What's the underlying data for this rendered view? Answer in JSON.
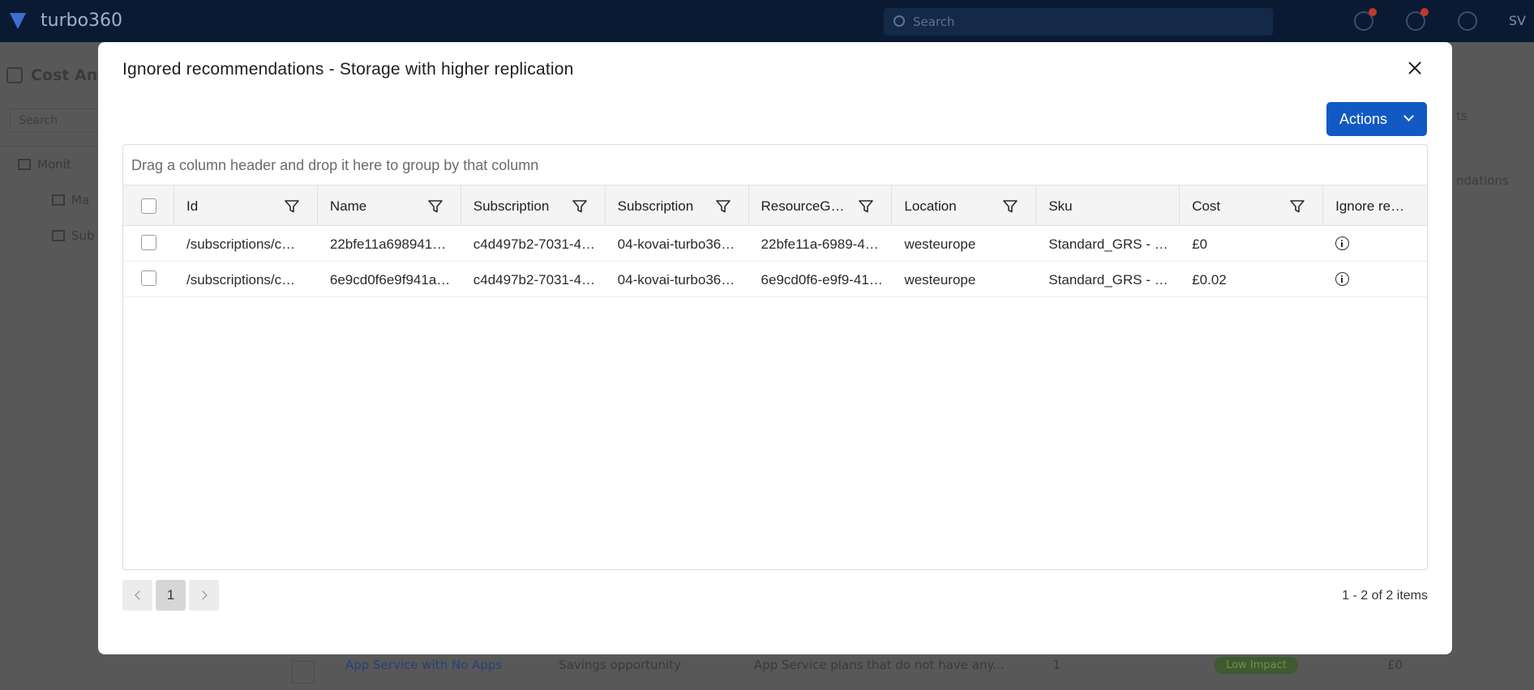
{
  "app": {
    "brand": "turbo360",
    "search_placeholder": "Search",
    "user_initials": "SV",
    "page_title": "Cost An",
    "sidebar_search": "Search",
    "sidebar_items": [
      "Monit",
      "Ma",
      "Sub"
    ],
    "bg_right_labels": [
      "ts",
      "ndations"
    ],
    "bg_row": {
      "name": "App Service with No Apps",
      "category": "Savings opportunity",
      "description": "App Service plans that do not have any...",
      "count": "1",
      "status": "Low Impact",
      "extra": "£0"
    }
  },
  "modal": {
    "title": "Ignored recommendations - Storage with higher replication",
    "actions_label": "Actions",
    "group_panel_hint": "Drag a column header and drop it here to group by that column",
    "columns": [
      {
        "label": "Id",
        "filter": true
      },
      {
        "label": "Name",
        "filter": true
      },
      {
        "label": "Subscription",
        "filter": true
      },
      {
        "label": "Subscription",
        "filter": true
      },
      {
        "label": "ResourceGroup",
        "filter": true
      },
      {
        "label": "Location",
        "filter": true
      },
      {
        "label": "Sku",
        "filter": false
      },
      {
        "label": "Cost",
        "filter": true
      },
      {
        "label": "Ignore re…",
        "filter": false
      }
    ],
    "rows": [
      {
        "id": "/subscriptions/c…",
        "name": "22bfe11a6989414…",
        "subscription_id": "c4d497b2-7031-4…",
        "subscription_name": "04-kovai-turbo36…",
        "resource_group": "22bfe11a-6989-41…",
        "location": "westeurope",
        "sku": "Standard_GRS - …",
        "cost": "£0"
      },
      {
        "id": "/subscriptions/c…",
        "name": "6e9cd0f6e9f941a…",
        "subscription_id": "c4d497b2-7031-4…",
        "subscription_name": "04-kovai-turbo36…",
        "resource_group": "6e9cd0f6-e9f9-41…",
        "location": "westeurope",
        "sku": "Standard_GRS - …",
        "cost": "£0.02"
      }
    ],
    "pagination": {
      "current_page": "1",
      "summary": "1 - 2 of 2 items"
    }
  },
  "colors": {
    "primary": "#1259c3",
    "overlay": "#5a5a5a",
    "topbar": "#0b1a33"
  }
}
